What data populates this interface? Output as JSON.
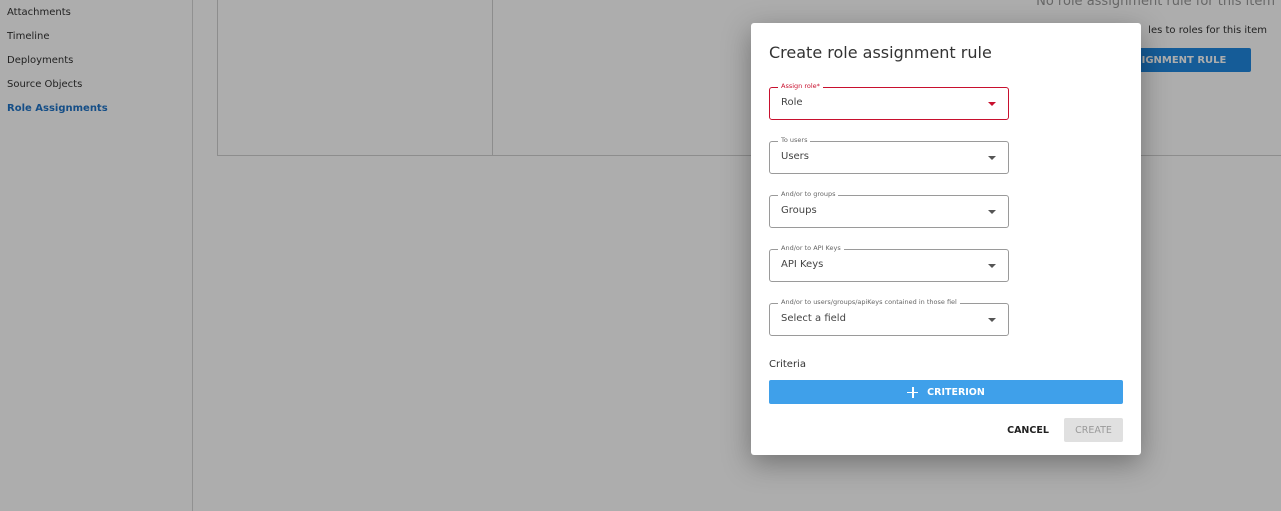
{
  "sidebar": {
    "items": [
      {
        "label": "Attachments"
      },
      {
        "label": "Timeline"
      },
      {
        "label": "Deployments"
      },
      {
        "label": "Source Objects"
      },
      {
        "label": "Role Assignments"
      }
    ],
    "active": "Role Assignments"
  },
  "background": {
    "empty_title": "No role assignment rule for this item",
    "empty_subtitle": "les to roles for this item",
    "create_button_label": "E ASSIGNMENT RULE"
  },
  "modal": {
    "title": "Create role assignment rule",
    "fields": {
      "role": {
        "label": "Assign role*",
        "value": "Role"
      },
      "users": {
        "label": "To users",
        "value": "Users"
      },
      "groups": {
        "label": "And/or to groups",
        "value": "Groups"
      },
      "api_keys": {
        "label": "And/or to API Keys",
        "value": "API Keys"
      },
      "field": {
        "label": "And/or to users/groups/apiKeys contained in those fiel",
        "value": "Select a field"
      }
    },
    "criteria_label": "Criteria",
    "criterion_button": "CRITERION",
    "cancel_button": "CANCEL",
    "create_button": "CREATE"
  },
  "colors": {
    "accent": "#3fa0ea",
    "active_nav": "#1f74c7",
    "error": "#c8102e",
    "disabled": "#e0e0e0"
  }
}
